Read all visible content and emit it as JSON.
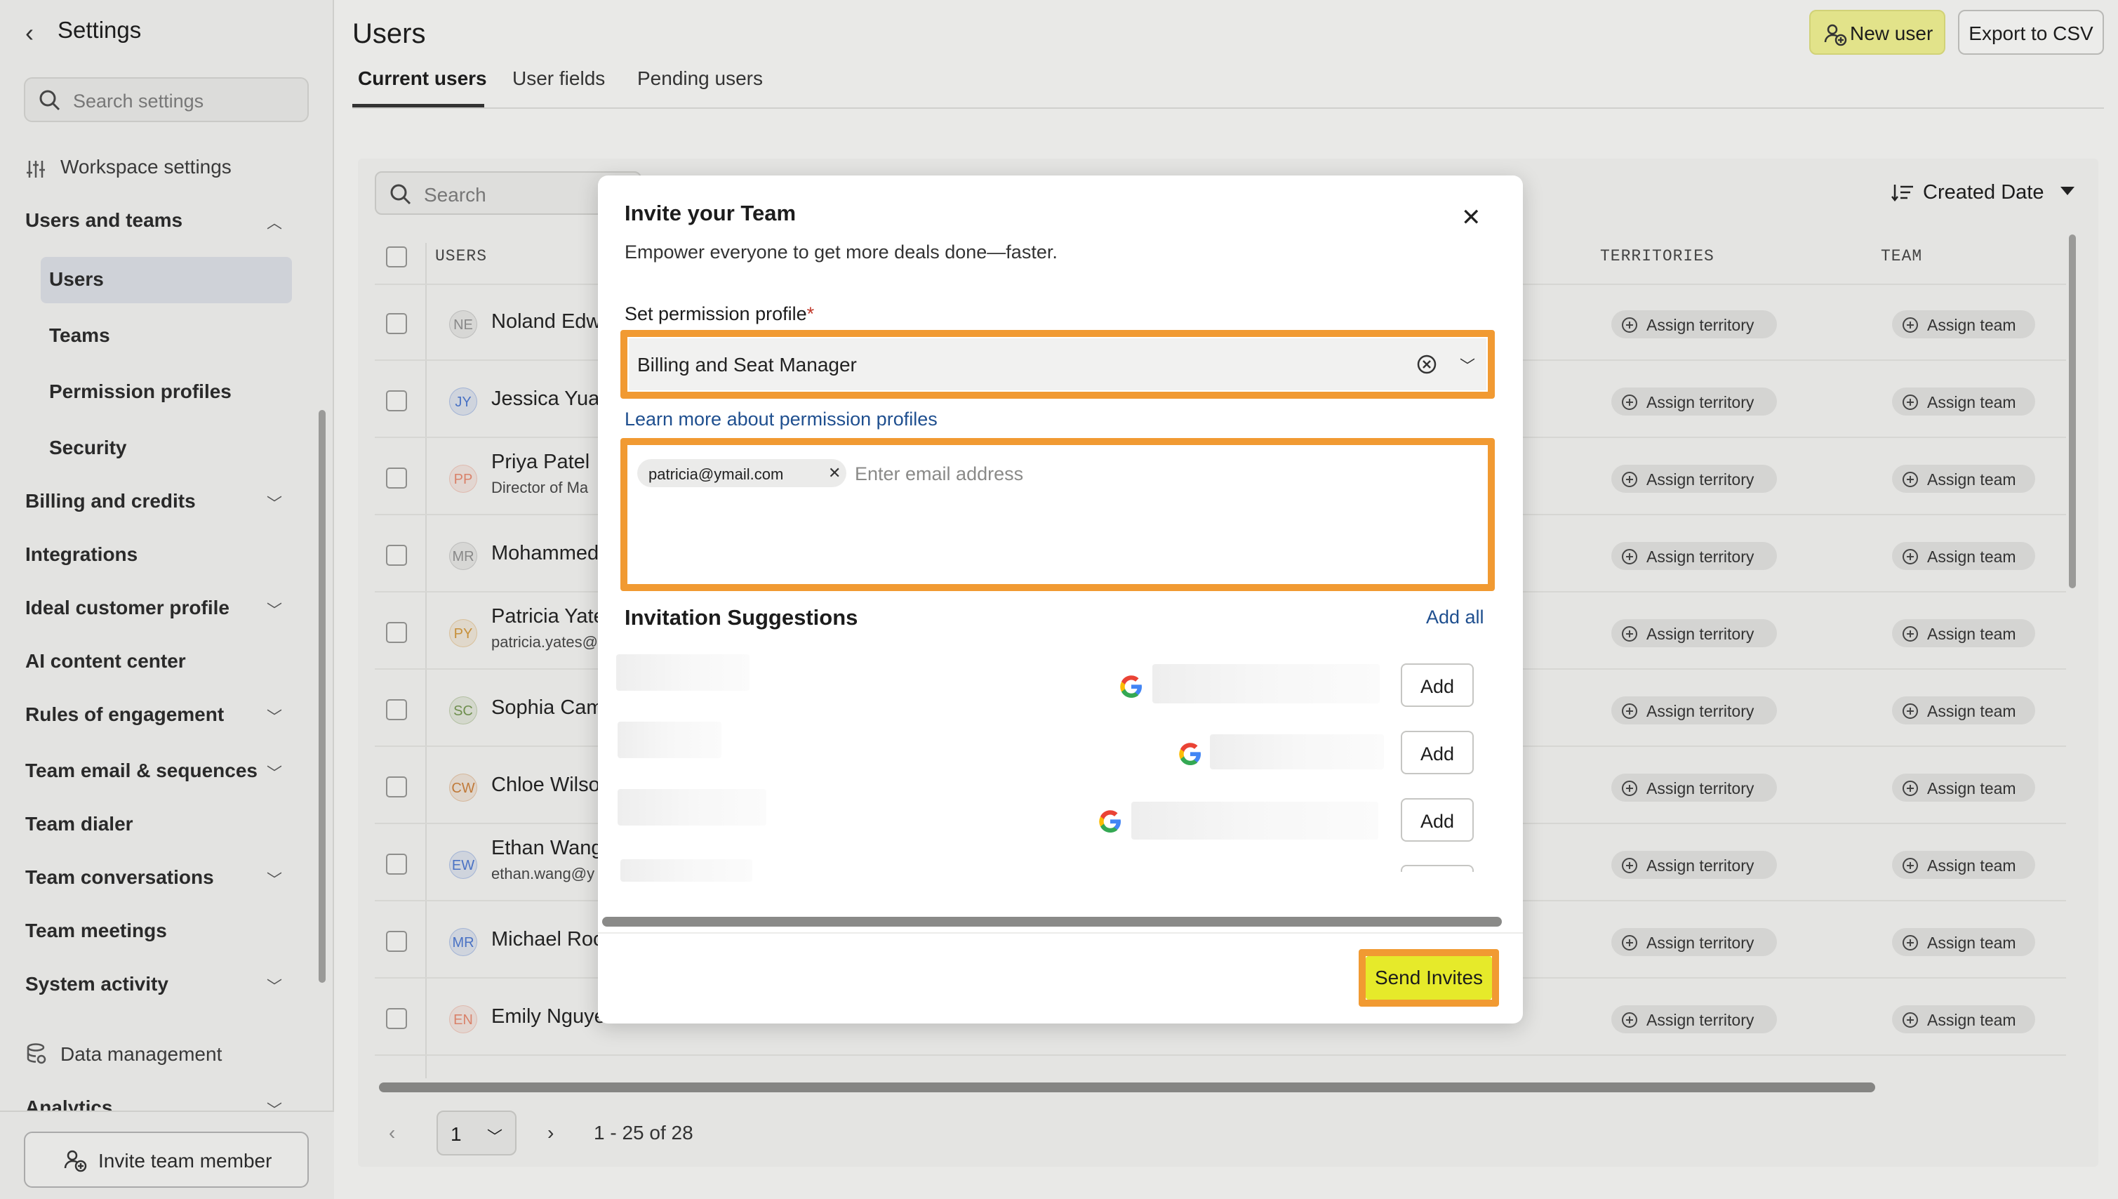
{
  "sidebar": {
    "title": "Settings",
    "search_placeholder": "Search settings",
    "workspace_settings": "Workspace settings",
    "users_and_teams": "Users and teams",
    "sub_items": [
      "Users",
      "Teams",
      "Permission profiles",
      "Security"
    ],
    "items": [
      {
        "label": "Billing and credits",
        "expandable": true
      },
      {
        "label": "Integrations",
        "expandable": false
      },
      {
        "label": "Ideal customer profile",
        "expandable": true
      },
      {
        "label": "AI content center",
        "expandable": false
      },
      {
        "label": "Rules of engagement",
        "expandable": true
      },
      {
        "label": "Team email & sequences",
        "expandable": true
      },
      {
        "label": "Team dialer",
        "expandable": false
      },
      {
        "label": "Team conversations",
        "expandable": true
      },
      {
        "label": "Team meetings",
        "expandable": false
      },
      {
        "label": "System activity",
        "expandable": true
      }
    ],
    "data_management": "Data management",
    "analytics": "Analytics",
    "invite_button": "Invite team member"
  },
  "header": {
    "title": "Users",
    "new_user": "New user",
    "export": "Export to CSV",
    "tabs": [
      "Current users",
      "User fields",
      "Pending users"
    ]
  },
  "table": {
    "search_placeholder": "Search",
    "sort_label": "Created Date",
    "columns": {
      "users": "USERS",
      "territories": "TERRITORIES",
      "team": "TEAM"
    },
    "rows": [
      {
        "initials": "NE",
        "name": "Noland Edw",
        "sub": "",
        "color": "#888888"
      },
      {
        "initials": "JY",
        "name": "Jessica Yuar",
        "sub": "",
        "color": "#4a72c4"
      },
      {
        "initials": "PP",
        "name": "Priya Patel",
        "sub": "Director of Ma",
        "color": "#d9826a"
      },
      {
        "initials": "MR",
        "name": "Mohammed",
        "sub": "",
        "color": "#888888"
      },
      {
        "initials": "PY",
        "name": "Patricia Yate",
        "sub": "patricia.yates@",
        "color": "#c7903a"
      },
      {
        "initials": "SC",
        "name": "Sophia Cam",
        "sub": "",
        "color": "#6f8f4e"
      },
      {
        "initials": "CW",
        "name": "Chloe Wilso",
        "sub": "",
        "color": "#c07a3a"
      },
      {
        "initials": "EW",
        "name": "Ethan Wang",
        "sub": "ethan.wang@y",
        "color": "#4a72c4"
      },
      {
        "initials": "MR",
        "name": "Michael Roc",
        "sub": "",
        "color": "#4a72c4"
      },
      {
        "initials": "EN",
        "name": "Emily Nguye",
        "sub": "",
        "color": "#d9826a"
      }
    ],
    "assign_territory": "Assign territory",
    "assign_team": "Assign team"
  },
  "pagination": {
    "page": "1",
    "info": "1 - 25 of 28"
  },
  "modal": {
    "title": "Invite your Team",
    "subtitle": "Empower everyone to get more deals done—faster.",
    "permission_label": "Set permission profile",
    "required_mark": "*",
    "permission_value": "Billing and Seat Manager",
    "learn_more": "Learn more about permission profiles",
    "email_chip": "patricia@ymail.com",
    "email_placeholder": "Enter email address",
    "suggestions_title": "Invitation Suggestions",
    "add_all": "Add all",
    "add_label": "Add",
    "send": "Send Invites"
  },
  "colors": {
    "highlight": "#f19a32",
    "send_button": "#e6ea2a",
    "new_user_button": "#e2e38a",
    "link": "#1f4f8f"
  }
}
